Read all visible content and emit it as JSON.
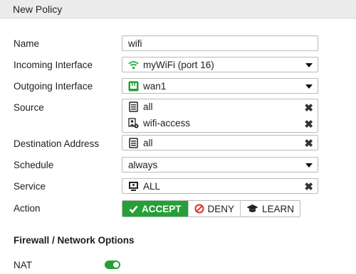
{
  "header": {
    "title": "New Policy"
  },
  "form": {
    "name": {
      "label": "Name",
      "value": "wifi"
    },
    "incoming": {
      "label": "Incoming Interface",
      "value": "myWiFi (port 16)",
      "icon": "wifi-icon"
    },
    "outgoing": {
      "label": "Outgoing Interface",
      "value": "wan1",
      "icon": "port-icon"
    },
    "source": {
      "label": "Source",
      "items": [
        {
          "value": "all",
          "icon": "address-list-icon"
        },
        {
          "value": "wifi-access",
          "icon": "user-group-icon"
        }
      ]
    },
    "destination": {
      "label": "Destination Address",
      "value": "all",
      "icon": "address-list-icon"
    },
    "schedule": {
      "label": "Schedule",
      "value": "always"
    },
    "service": {
      "label": "Service",
      "value": "ALL",
      "icon": "service-icon"
    },
    "action": {
      "label": "Action",
      "options": [
        {
          "label": "ACCEPT",
          "icon": "check-icon",
          "selected": true
        },
        {
          "label": "DENY",
          "icon": "deny-icon",
          "selected": false
        },
        {
          "label": "LEARN",
          "icon": "graduation-cap-icon",
          "selected": false
        }
      ]
    }
  },
  "firewall_options": {
    "title": "Firewall / Network Options",
    "nat": {
      "label": "NAT",
      "enabled": true
    }
  },
  "colors": {
    "accent_green": "#24a036",
    "header_bg": "#ececec",
    "wifi_green": "#2db34a",
    "deny_red": "#d9332b"
  }
}
